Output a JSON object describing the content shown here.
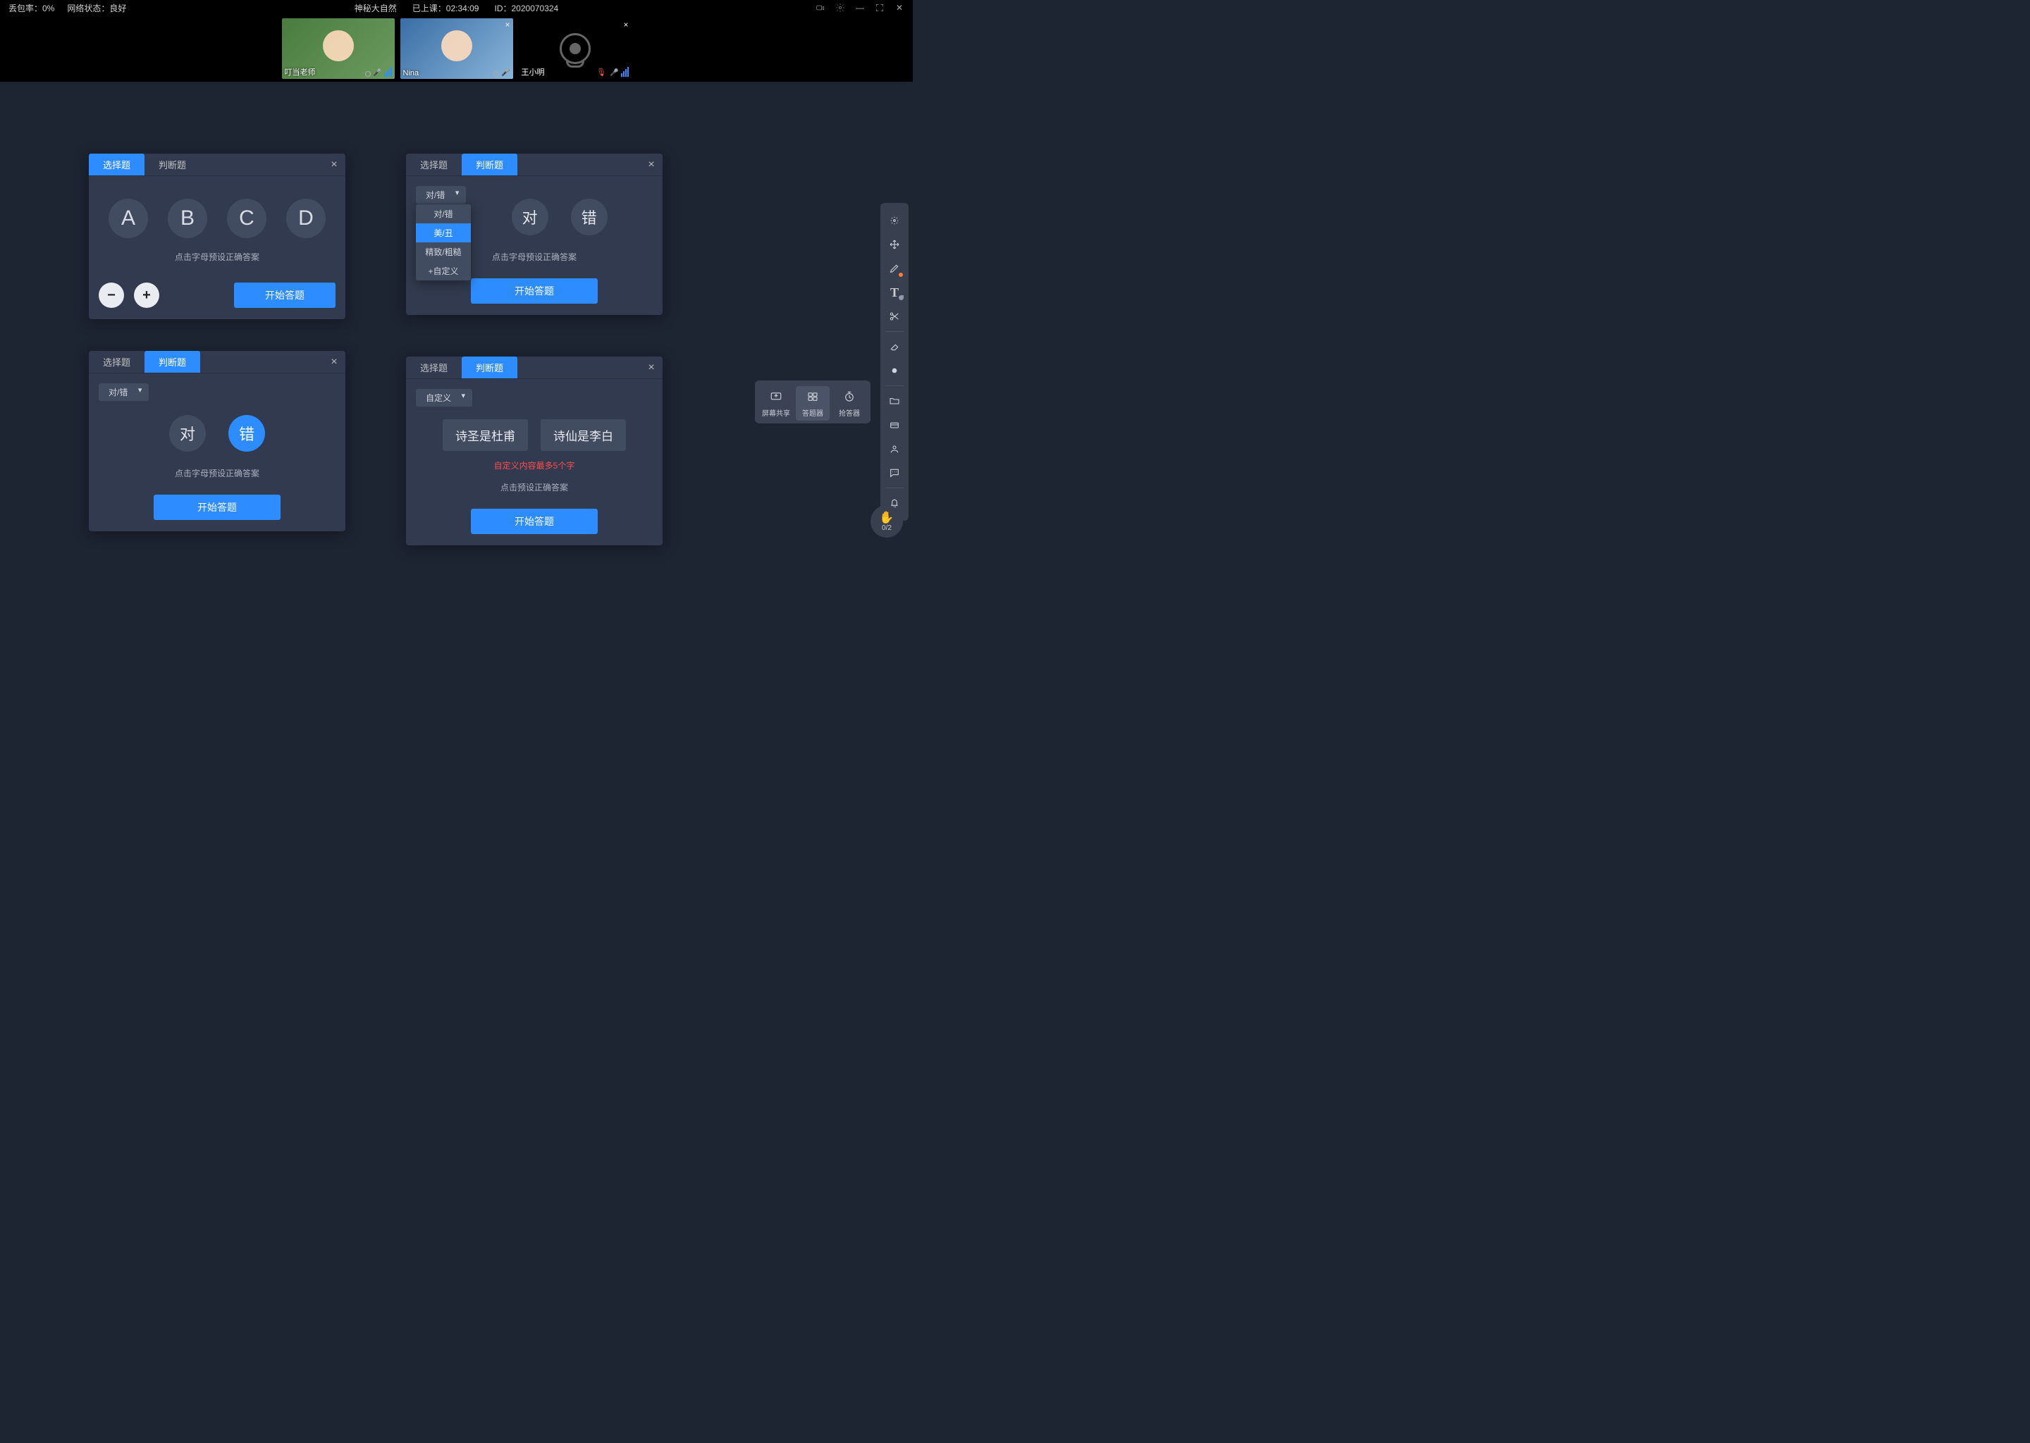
{
  "titlebar": {
    "packet_loss_label": "丢包率：0%",
    "network_label": "网络状态：良好",
    "course": "神秘大自然",
    "elapsed": "已上课：02:34:09",
    "id": "ID：2020070324"
  },
  "videos": {
    "host": "叮当老师",
    "nina": "Nina",
    "student": "王小明"
  },
  "panel_choice": {
    "tab_choice": "选择题",
    "tab_tf": "判断题",
    "a": "A",
    "b": "B",
    "c": "C",
    "d": "D",
    "hint": "点击字母预设正确答案",
    "start": "开始答题"
  },
  "panel_tf_dd": {
    "tab_choice": "选择题",
    "tab_tf": "判断题",
    "dd_label": "对/错",
    "opt1": "对/错",
    "opt2": "美/丑",
    "opt3": "精致/粗糙",
    "opt4": "+自定义",
    "true": "对",
    "false": "错",
    "hint": "点击字母预设正确答案",
    "start": "开始答题"
  },
  "panel_tf_sel": {
    "tab_choice": "选择题",
    "tab_tf": "判断题",
    "dd_label": "对/错",
    "true": "对",
    "false": "错",
    "hint": "点击字母预设正确答案",
    "start": "开始答题"
  },
  "panel_custom": {
    "tab_choice": "选择题",
    "tab_tf": "判断题",
    "dd_label": "自定义",
    "opt1": "诗圣是杜甫",
    "opt2": "诗仙是李白",
    "warn": "自定义内容最多5个字",
    "hint": "点击预设正确答案",
    "start": "开始答题"
  },
  "quick": {
    "share": "屏幕共享",
    "answer": "答题器",
    "race": "抢答器"
  },
  "hand": {
    "count": "0/2"
  }
}
